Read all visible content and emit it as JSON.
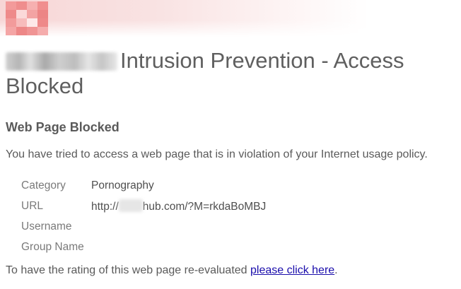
{
  "header": {
    "logo_icon": "pixelated-logo-icon",
    "accent_color": "#e87c7c"
  },
  "title": {
    "text": "Intrusion Prevention - Access Blocked"
  },
  "subtitle": "Web Page Blocked",
  "message": "You have tried to access a web page that is in violation of your Internet usage policy.",
  "details": [
    {
      "label": "Category",
      "value": "Pornography"
    },
    {
      "label": "URL",
      "value_prefix": "http://",
      "value_suffix": "hub.com/?M=rkdaBoMBJ"
    },
    {
      "label": "Username",
      "value": ""
    },
    {
      "label": "Group Name",
      "value": ""
    }
  ],
  "footer": {
    "text": "To have the rating of this web page re-evaluated ",
    "link_text": "please click here",
    "end_text": "."
  }
}
